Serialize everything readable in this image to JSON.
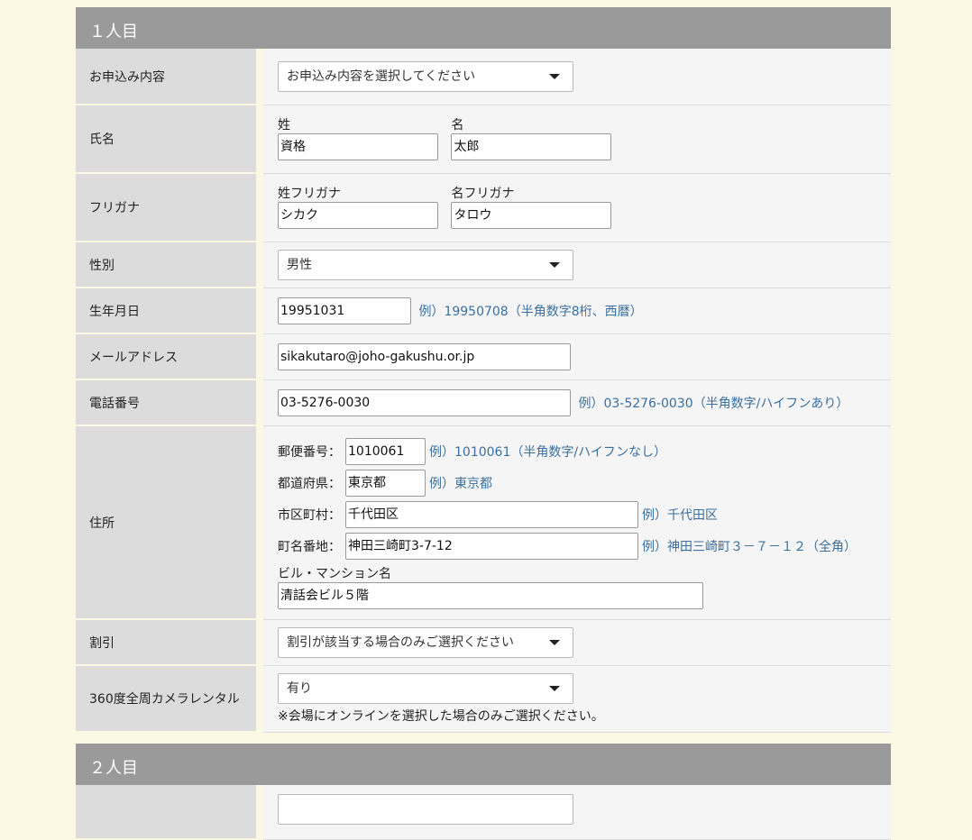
{
  "section1": {
    "heading": "１人目",
    "application": {
      "label": "お申込み内容",
      "selected": "お申込み内容を選択してください"
    },
    "name": {
      "label": "氏名",
      "last_label": "姓",
      "last_value": "資格",
      "first_label": "名",
      "first_value": "太郎"
    },
    "kana": {
      "label": "フリガナ",
      "last_label": "姓フリガナ",
      "last_value": "シカク",
      "first_label": "名フリガナ",
      "first_value": "タロウ"
    },
    "gender": {
      "label": "性別",
      "selected": "男性"
    },
    "birthday": {
      "label": "生年月日",
      "value": "19951031",
      "example": "例）19950708（半角数字8桁、西暦）"
    },
    "email": {
      "label": "メールアドレス",
      "value": "sikakutaro@joho-gakushu.or.jp"
    },
    "phone": {
      "label": "電話番号",
      "value": "03-5276-0030",
      "example": "例）03-5276-0030（半角数字/ハイフンあり）"
    },
    "address": {
      "label": "住所",
      "postal_label": "郵便番号：",
      "postal_value": "1010061",
      "postal_example": "例）1010061（半角数字/ハイフンなし）",
      "pref_label": "都道府県：",
      "pref_value": "東京都",
      "pref_example": "例）東京都",
      "city_label": "市区町村：",
      "city_value": "千代田区",
      "city_example": "例）千代田区",
      "street_label": "町名番地：",
      "street_value": "神田三崎町3-7-12",
      "street_example": "例）神田三崎町３－７－１２（全角）",
      "building_label": "ビル・マンション名",
      "building_value": "清話会ビル５階"
    },
    "discount": {
      "label": "割引",
      "selected": "割引が該当する場合のみご選択ください"
    },
    "camera": {
      "label": "360度全周カメラレンタル",
      "selected": "有り",
      "note": "※会場にオンラインを選択した場合のみご選択ください。"
    }
  },
  "section2": {
    "heading": "２人目"
  }
}
